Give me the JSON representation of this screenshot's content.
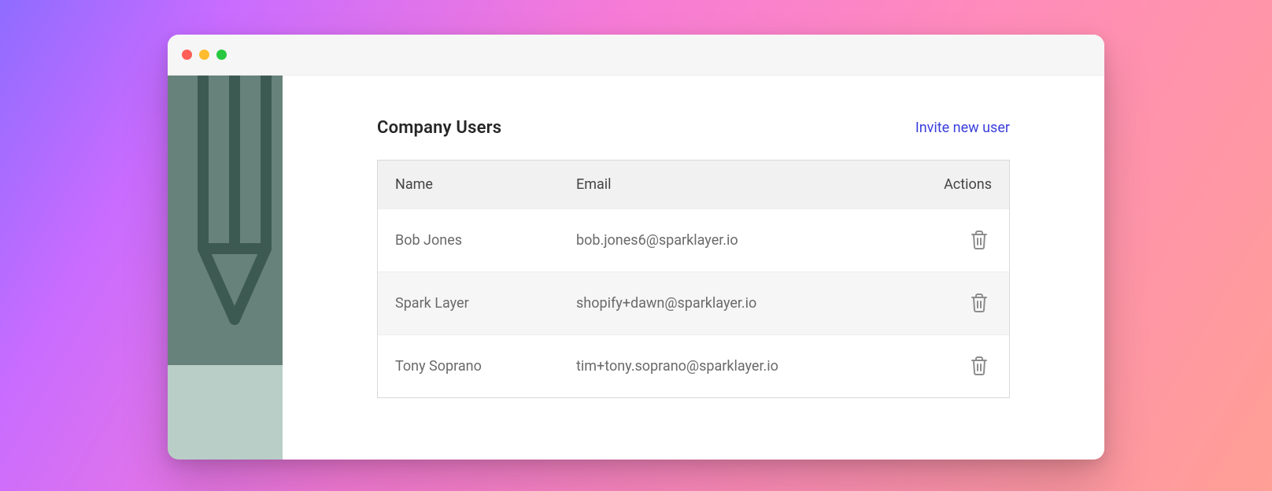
{
  "page": {
    "title": "Company Users",
    "invite_label": "Invite new user"
  },
  "table": {
    "columns": {
      "name": "Name",
      "email": "Email",
      "actions": "Actions"
    },
    "rows": [
      {
        "name": "Bob Jones",
        "email": "bob.jones6@sparklayer.io"
      },
      {
        "name": "Spark Layer",
        "email": "shopify+dawn@sparklayer.io"
      },
      {
        "name": "Tony Soprano",
        "email": "tim+tony.soprano@sparklayer.io"
      }
    ]
  }
}
